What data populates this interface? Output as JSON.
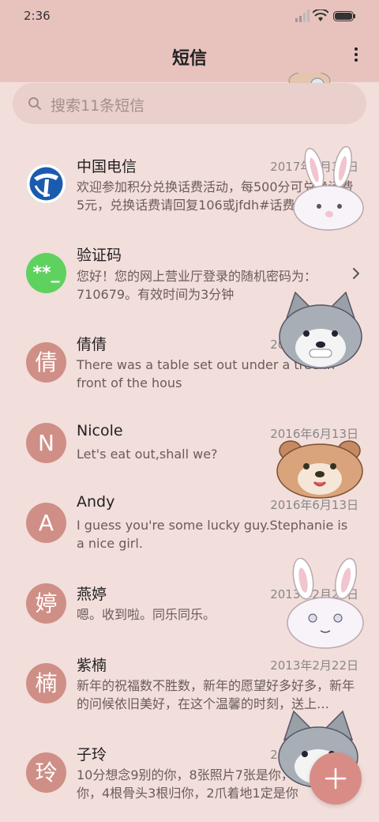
{
  "status_bar": {
    "time": "2:36"
  },
  "header": {
    "title": "短信"
  },
  "search": {
    "placeholder": "搜索11条短信"
  },
  "conversations": [
    {
      "name": "中国电信",
      "date": "2017年6月30日",
      "preview": "欢迎参加积分兑换话费活动，每500分可兑换话费5元，兑换话费请回复106或jfdh#话费金额…",
      "avatar": ""
    },
    {
      "name": "验证码",
      "date": "",
      "preview": "您好！您的网上营业厅登录的随机密码为：710679。有效时间为3分钟",
      "avatar": "**_"
    },
    {
      "name": "倩倩",
      "date": "2016年6月13日",
      "preview": "There was a table set out under a tree in front of the hous",
      "avatar": "倩"
    },
    {
      "name": "Nicole",
      "date": "2016年6月13日",
      "preview": "Let's eat out,shall we?",
      "avatar": "N"
    },
    {
      "name": "Andy",
      "date": "2016年6月13日",
      "preview": "I guess you're some lucky guy.Stephanie is a nice girl.",
      "avatar": "A"
    },
    {
      "name": "燕婷",
      "date": "2013年2月22日",
      "preview": "嗯。收到啦。同乐同乐。",
      "avatar": "婷"
    },
    {
      "name": "紫楠",
      "date": "2013年2月22日",
      "preview": "新年的祝福数不胜数，新年的愿望好多好多，新年的问候依旧美好，在这个温馨的时刻，送上…",
      "avatar": "楠"
    },
    {
      "name": "子玲",
      "date": "2013年2月22日",
      "preview": "10分想念9别的你，8张照片7张是你，6天只像你，4根骨头3根归你，2爪着地1定是你",
      "avatar": "玲"
    }
  ],
  "colors": {
    "header_bg": "#e8c3be",
    "page_bg": "#f2dedb",
    "avatar_bg": "#cf8f86",
    "fab_bg": "#d98c86",
    "verify_green": "#5fd15f"
  },
  "icons": {
    "signal": "signal-icon",
    "wifi": "wifi-icon",
    "battery": "battery-icon",
    "more": "more-vertical-icon",
    "search": "search-icon",
    "chevron": "chevron-right-icon",
    "compose": "plus-icon"
  }
}
